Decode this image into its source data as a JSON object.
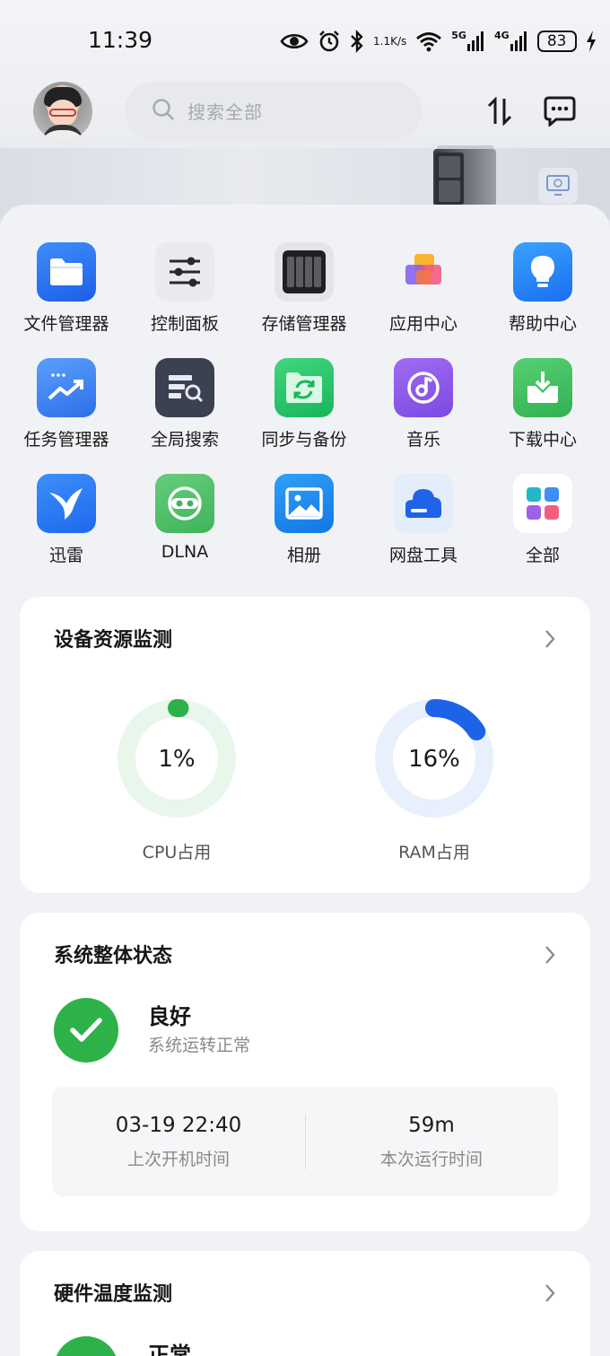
{
  "status_bar": {
    "time": "11:39",
    "net_speed_value": "1.1",
    "net_speed_unit": "K/s",
    "signal_1_label": "5G",
    "signal_2_label": "4G",
    "battery": "83"
  },
  "header": {
    "search_placeholder": "搜索全部"
  },
  "apps": [
    {
      "label": "文件管理器",
      "icon": "folder-icon"
    },
    {
      "label": "控制面板",
      "icon": "sliders-icon"
    },
    {
      "label": "存储管理器",
      "icon": "storage-icon"
    },
    {
      "label": "应用中心",
      "icon": "app-center-icon"
    },
    {
      "label": "帮助中心",
      "icon": "lightbulb-icon"
    },
    {
      "label": "任务管理器",
      "icon": "task-chart-icon"
    },
    {
      "label": "全局搜索",
      "icon": "global-search-icon"
    },
    {
      "label": "同步与备份",
      "icon": "sync-folder-icon"
    },
    {
      "label": "音乐",
      "icon": "music-icon"
    },
    {
      "label": "下载中心",
      "icon": "download-icon"
    },
    {
      "label": "迅雷",
      "icon": "thunder-bird-icon"
    },
    {
      "label": "DLNA",
      "icon": "dlna-icon"
    },
    {
      "label": "相册",
      "icon": "photo-icon"
    },
    {
      "label": "网盘工具",
      "icon": "cloud-drive-icon"
    },
    {
      "label": "全部",
      "icon": "grid-all-icon"
    }
  ],
  "resource_monitor": {
    "title": "设备资源监测",
    "cpu": {
      "value_text": "1%",
      "label": "CPU占用",
      "percent": 1,
      "color": "#2db24a",
      "track": "#e9f6ec"
    },
    "ram": {
      "value_text": "16%",
      "label": "RAM占用",
      "percent": 16,
      "color": "#1d63e8",
      "track": "#e8f0fd"
    }
  },
  "system_status": {
    "title": "系统整体状态",
    "state": "良好",
    "state_desc": "系统运转正常",
    "last_boot_value": "03-19 22:40",
    "last_boot_label": "上次开机时间",
    "uptime_value": "59m",
    "uptime_label": "本次运行时间"
  },
  "hardware_temp": {
    "title": "硬件温度监测",
    "state": "正常"
  }
}
